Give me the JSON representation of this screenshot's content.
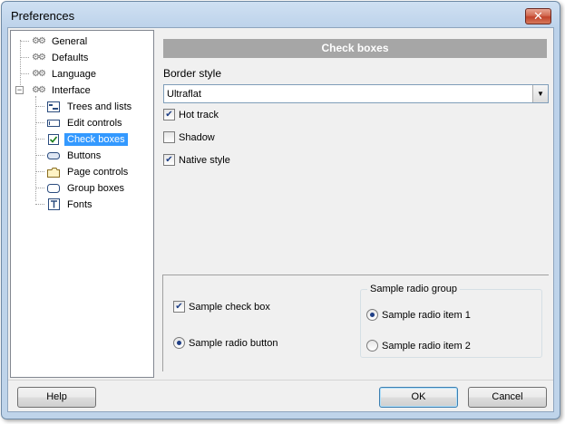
{
  "window": {
    "title": "Preferences",
    "close_glyph": "✕"
  },
  "tree": {
    "items": [
      {
        "label": "General",
        "icon": "gear-icon"
      },
      {
        "label": "Defaults",
        "icon": "gear-icon"
      },
      {
        "label": "Language",
        "icon": "gear-icon"
      },
      {
        "label": "Interface",
        "icon": "gear-icon",
        "expanded": true
      },
      {
        "label": "Trees and lists",
        "icon": "tree-list-icon"
      },
      {
        "label": "Edit controls",
        "icon": "edit-control-icon"
      },
      {
        "label": "Check boxes",
        "icon": "checkbox-icon",
        "selected": true
      },
      {
        "label": "Buttons",
        "icon": "button-icon"
      },
      {
        "label": "Page controls",
        "icon": "page-control-icon"
      },
      {
        "label": "Group boxes",
        "icon": "group-box-icon"
      },
      {
        "label": "Fonts",
        "icon": "font-icon"
      }
    ]
  },
  "panel": {
    "header": "Check boxes",
    "border_style_label": "Border style",
    "border_style_value": "Ultraflat",
    "options": [
      {
        "label": "Hot track",
        "checked": true
      },
      {
        "label": "Shadow",
        "checked": false
      },
      {
        "label": "Native style",
        "checked": true
      }
    ]
  },
  "sample": {
    "check_box_label": "Sample check box",
    "radio_button_label": "Sample radio button",
    "group_title": "Sample radio group",
    "radio_items": [
      "Sample radio item 1",
      "Sample radio item 2"
    ]
  },
  "buttons": {
    "help": "Help",
    "ok": "OK",
    "cancel": "Cancel"
  }
}
